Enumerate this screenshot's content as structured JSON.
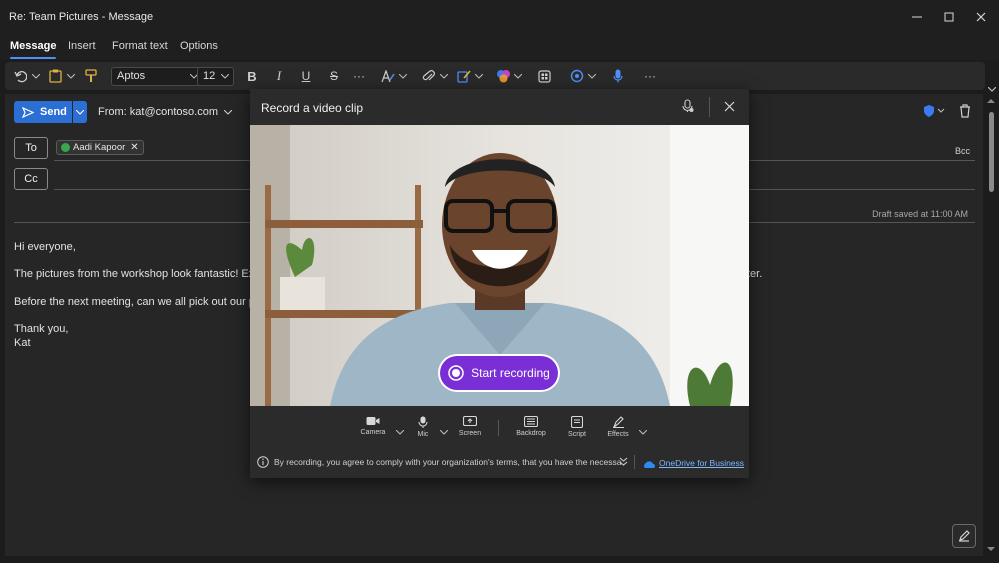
{
  "window": {
    "title": "Re: Team Pictures - Message"
  },
  "ribbon": {
    "tabs": [
      "Message",
      "Insert",
      "Format text",
      "Options"
    ],
    "active_tab": "Message",
    "font_name": "Aptos",
    "font_size": "12"
  },
  "compose": {
    "send_label": "Send",
    "from_label": "From: kat@contoso.com",
    "to_label": "To",
    "cc_label": "Cc",
    "bcc_label": "Bcc",
    "recipient": "Aadi Kapoor",
    "draft_status": "Draft saved at 11:00 AM",
    "body_lines": [
      "Hi everyone,",
      "The pictures from the workshop look fantastic! Exc",
      "ter.",
      "Before the next meeting, can we all pick out our pe",
      "Thank you,",
      "Kat"
    ]
  },
  "dialog": {
    "title": "Record a video clip",
    "start_recording": "Start recording",
    "controls": [
      "Camera",
      "Mic",
      "Screen",
      "Backdrop",
      "Script",
      "Effects"
    ],
    "disclaimer": "By recording, you agree to comply with your organization's terms, that you have the necessa",
    "storage_link": "OneDrive for Business"
  },
  "colors": {
    "accent": "#2b6ed4",
    "record": "#7a2fd6",
    "background": "#1c1c1c"
  }
}
